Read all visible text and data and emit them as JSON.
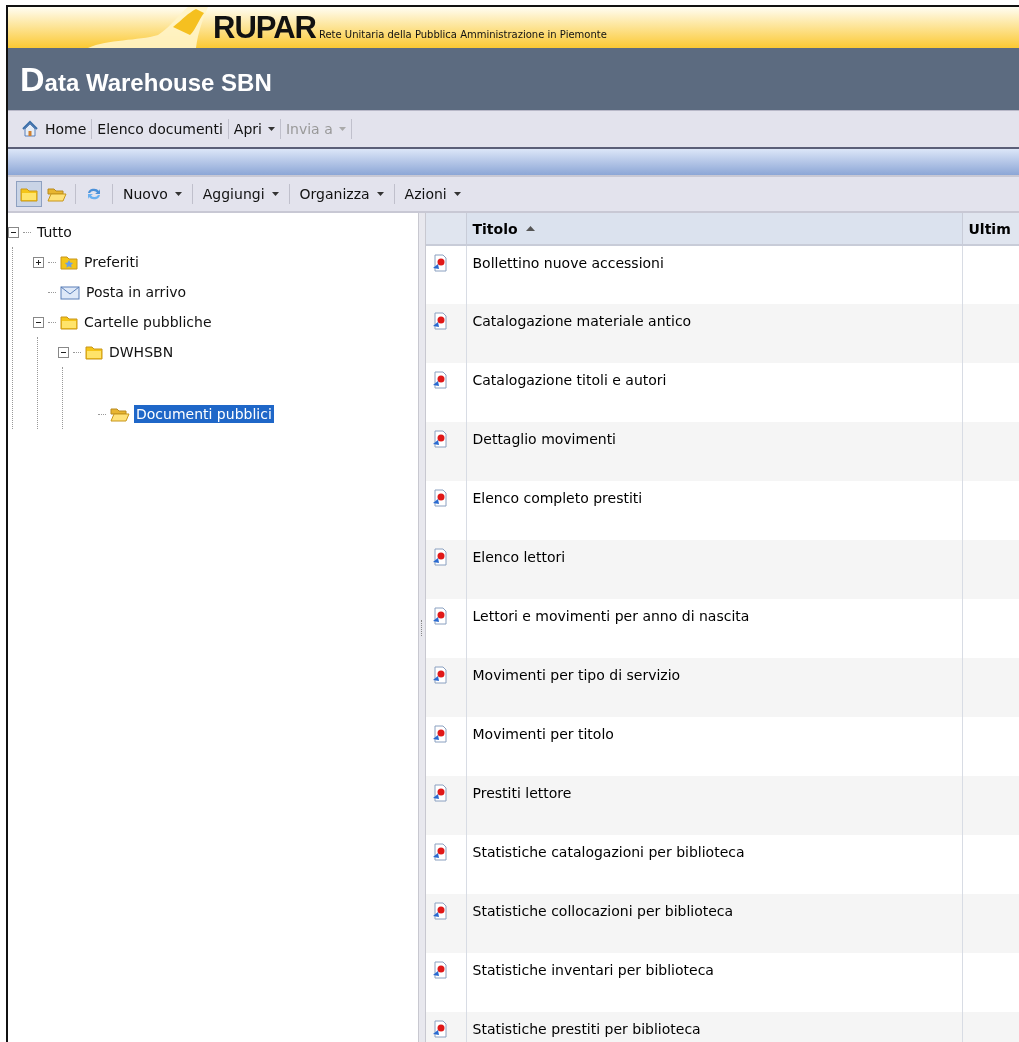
{
  "banner": {
    "logo": "RUPAR",
    "subtitle": "Rete Unitaria della Pubblica Amministrazione in Piemonte"
  },
  "app_title": "Data Warehouse SBN",
  "nav_toolbar": [
    {
      "label": "Home",
      "kind": "home",
      "disabled": false
    },
    {
      "label": "Elenco documenti",
      "kind": "plain",
      "disabled": false
    },
    {
      "label": "Apri",
      "kind": "dropdown",
      "disabled": false
    },
    {
      "label": "Invia a",
      "kind": "dropdown",
      "disabled": true
    }
  ],
  "toolbar": {
    "icon_buttons": [
      {
        "kind": "folder",
        "selected": true
      },
      {
        "kind": "open-folder",
        "selected": false
      },
      {
        "kind": "refresh",
        "selected": false
      }
    ],
    "menus": [
      "Nuovo",
      "Aggiungi",
      "Organizza",
      "Azioni"
    ]
  },
  "tree": [
    {
      "label": "Tutto",
      "expanded": true,
      "selected": false,
      "children": [
        {
          "label": "Preferiti",
          "kind": "star-folder",
          "expanded": false,
          "selected": false
        },
        {
          "label": "Posta in arrivo",
          "kind": "mail",
          "selected": false
        },
        {
          "label": "Cartelle pubbliche",
          "kind": "folder",
          "expanded": true,
          "selected": false,
          "children": [
            {
              "label": "DWHSBN",
              "kind": "folder",
              "expanded": true,
              "selected": false,
              "children": [
                {
                  "label": "Documenti pubblici",
                  "kind": "open-folder",
                  "selected": true
                }
              ]
            }
          ]
        }
      ]
    }
  ],
  "table": {
    "columns": [
      {
        "label": "Titolo",
        "sorted": true
      },
      {
        "label": "Ultim"
      }
    ],
    "rows": [
      "Bollettino nuove accessioni",
      "Catalogazione materiale antico",
      "Catalogazione titoli e autori",
      "Dettaglio movimenti",
      "Elenco completo prestiti",
      "Elenco lettori",
      "Lettori e movimenti per anno di nascita",
      "Movimenti per tipo di servizio",
      "Movimenti per titolo",
      "Prestiti lettore",
      "Statistiche catalogazioni per biblioteca",
      "Statistiche collocazioni per biblioteca",
      "Statistiche inventari per biblioteca",
      "Statistiche prestiti per biblioteca"
    ]
  }
}
